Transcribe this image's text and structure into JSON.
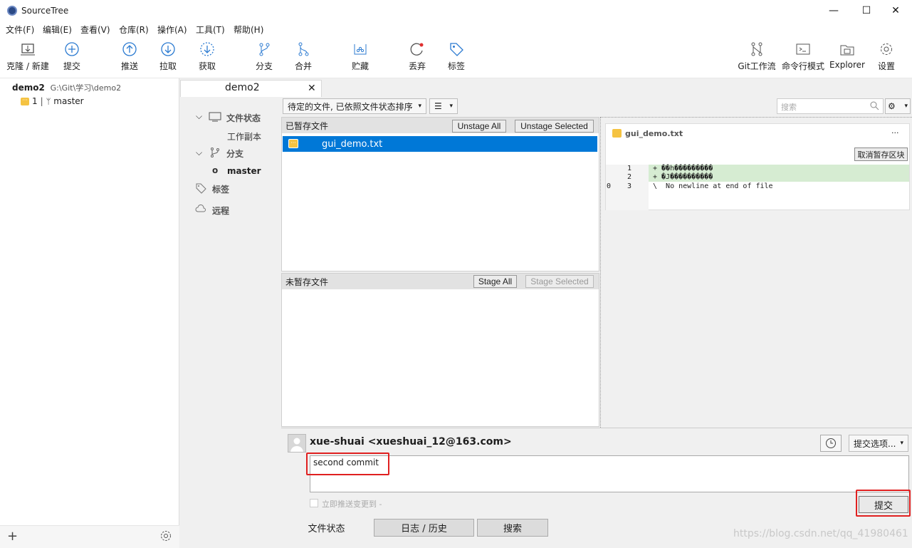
{
  "window": {
    "title": "SourceTree",
    "minimize": "—",
    "maximize": "☐",
    "close": "✕"
  },
  "menu": [
    "文件(F)",
    "编辑(E)",
    "查看(V)",
    "仓库(R)",
    "操作(A)",
    "工具(T)",
    "帮助(H)"
  ],
  "toolbar": {
    "clone": "克隆 / 新建",
    "commit": "提交",
    "push": "推送",
    "pull": "拉取",
    "fetch": "获取",
    "branch": "分支",
    "merge": "合并",
    "stash": "贮藏",
    "discard": "丢弃",
    "tag": "标签",
    "gitflow": "Git工作流",
    "terminal": "命令行模式",
    "explorer": "Explorer",
    "settings": "设置"
  },
  "repo": {
    "name": "demo2",
    "path": "G:\\Git\\学习\\demo2",
    "badge": "1",
    "branch": "master"
  },
  "tab": {
    "title": "demo2",
    "close": "✕"
  },
  "nav": {
    "file_status": "文件状态",
    "working_copy": "工作副本",
    "branches": "分支",
    "current_branch": "master",
    "tags": "标签",
    "remotes": "远程"
  },
  "filter": {
    "sort": "待定的文件, 已依照文件状态排序",
    "search_placeholder": "搜索"
  },
  "staged": {
    "title": "已暂存文件",
    "unstage_all": "Unstage All",
    "unstage_selected": "Unstage Selected",
    "files": [
      "gui_demo.txt"
    ]
  },
  "unstaged": {
    "title": "未暂存文件",
    "stage_all": "Stage All",
    "stage_selected": "Stage Selected"
  },
  "diff": {
    "file": "gui_demo.txt",
    "more": "···",
    "discard_hunk": "取消暂存区块",
    "lines": [
      {
        "old": "",
        "new": "1",
        "text": "+ ��h���������"
      },
      {
        "old": "",
        "new": "2",
        "text": "+ �J����������"
      },
      {
        "old": "0",
        "new": "3",
        "text": "\\  No newline at end of file"
      }
    ]
  },
  "commit": {
    "author": "xue-shuai <xueshuai_12@163.com>",
    "message": "second commit",
    "options": "提交选项...",
    "push_now": "立即推送变更到 -",
    "submit": "提交"
  },
  "bottom_tabs": {
    "status": "文件状态",
    "log": "日志 / 历史",
    "search": "搜索"
  },
  "watermark": "https://blog.csdn.net/qq_41980461",
  "colors": {
    "selection": "#0078d7",
    "badge": "#f5c342",
    "highlight": "#e02020",
    "added_line": "#d6ecd2"
  }
}
